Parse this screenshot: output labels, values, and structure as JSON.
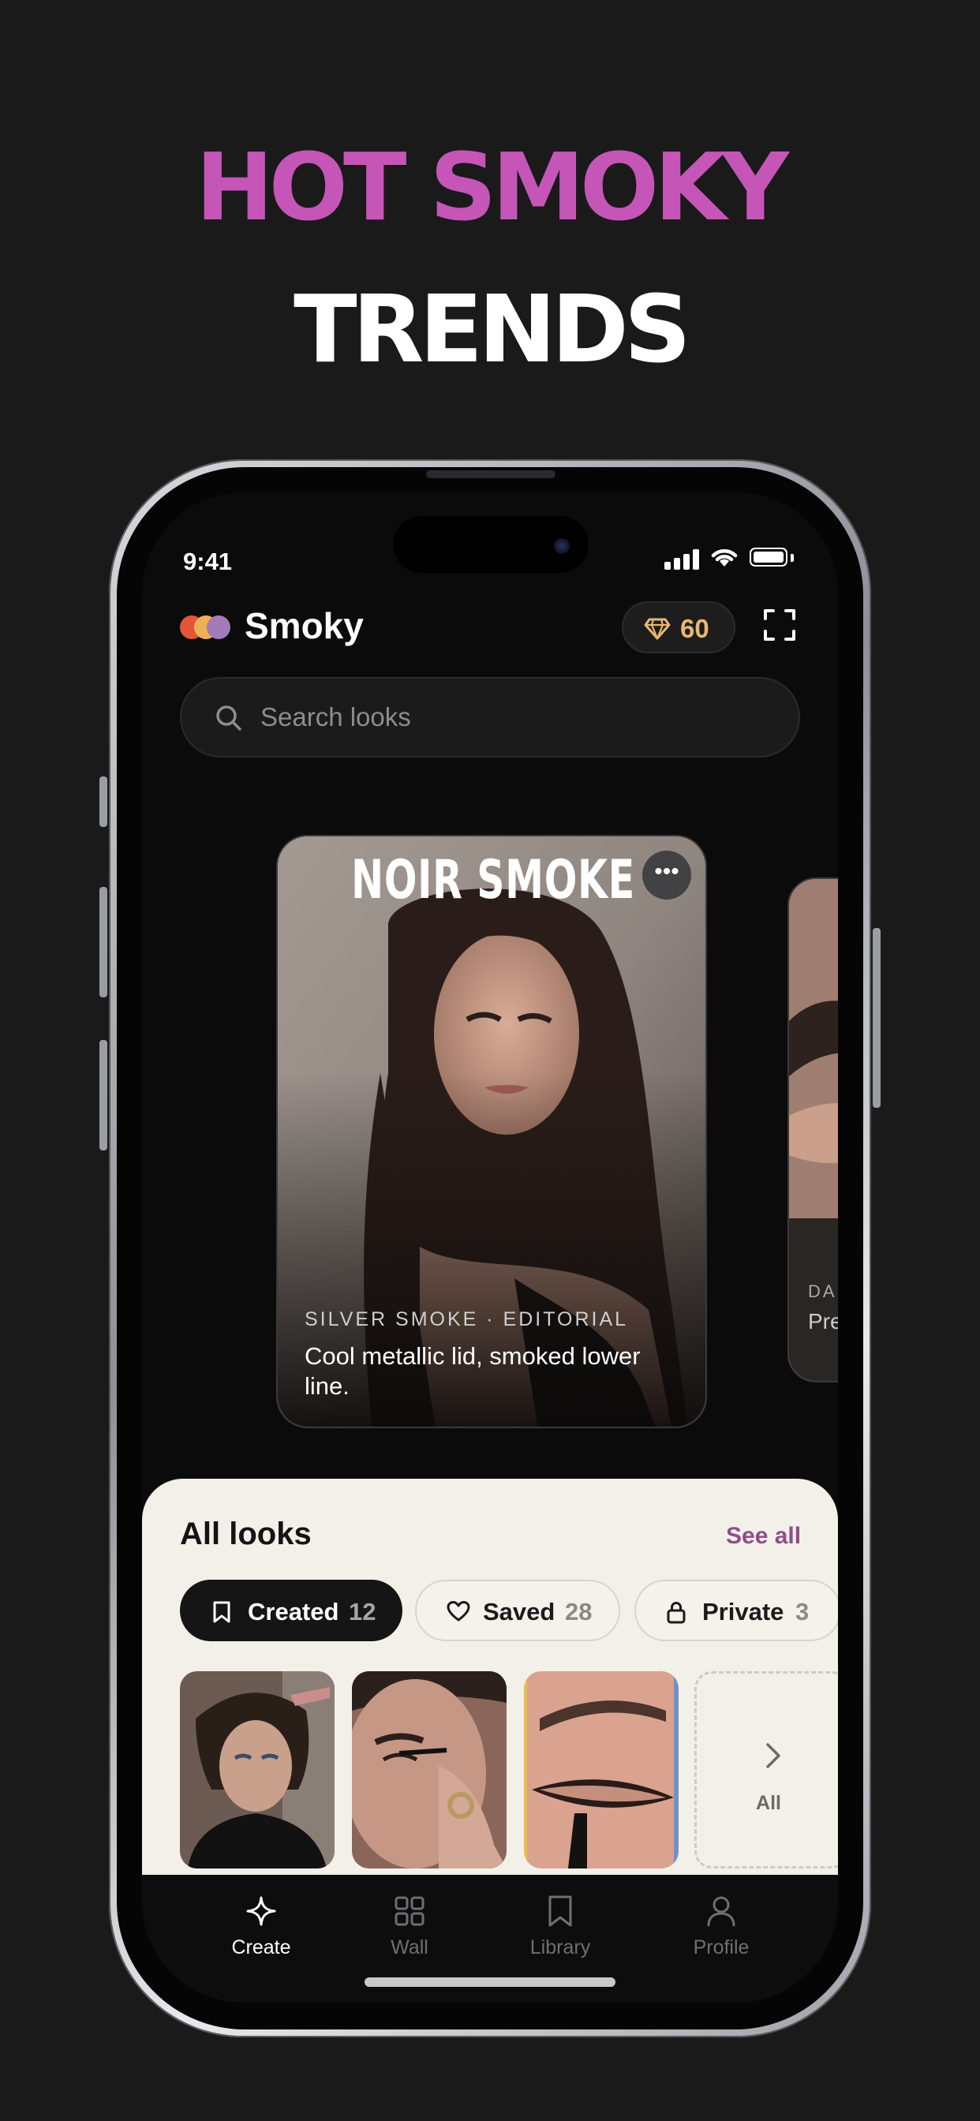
{
  "promo": {
    "headline_line1": "HOT SMOKY",
    "headline_line2": "TRENDS",
    "accent_color": "#c556b8"
  },
  "status_bar": {
    "time": "9:41",
    "icons": [
      "signal-icon",
      "wifi-icon",
      "battery-icon"
    ]
  },
  "header": {
    "app_name": "Smoky",
    "logo_colors": [
      "#e4563a",
      "#f0ae55",
      "#a57ab8"
    ],
    "gems_count": "60",
    "gem_icon": "gem-icon",
    "expand_icon": "expand-icon"
  },
  "search": {
    "placeholder": "Search looks",
    "value": ""
  },
  "featured_card": {
    "title": "NOIR SMOKE",
    "tag": "SILVER SMOKE · EDITORIAL",
    "description": "Cool metallic lid, smoked lower line."
  },
  "next_card": {
    "tag": "DA",
    "description": "Pre sm"
  },
  "all_looks": {
    "title": "All looks",
    "see_all": "See all",
    "filters": [
      {
        "label": "Created",
        "count": "12",
        "icon": "bookmark-icon",
        "active": true
      },
      {
        "label": "Saved",
        "count": "28",
        "icon": "heart-icon",
        "active": false
      },
      {
        "label": "Private",
        "count": "3",
        "icon": "lock-icon",
        "active": false
      }
    ],
    "more_tile_label": "All"
  },
  "tab_bar": {
    "tabs": [
      {
        "label": "Create",
        "icon": "sparkle-icon",
        "active": true
      },
      {
        "label": "Wall",
        "icon": "grid-icon",
        "active": false
      },
      {
        "label": "Library",
        "icon": "bookmark-icon",
        "active": false
      },
      {
        "label": "Profile",
        "icon": "person-icon",
        "active": false
      }
    ]
  }
}
